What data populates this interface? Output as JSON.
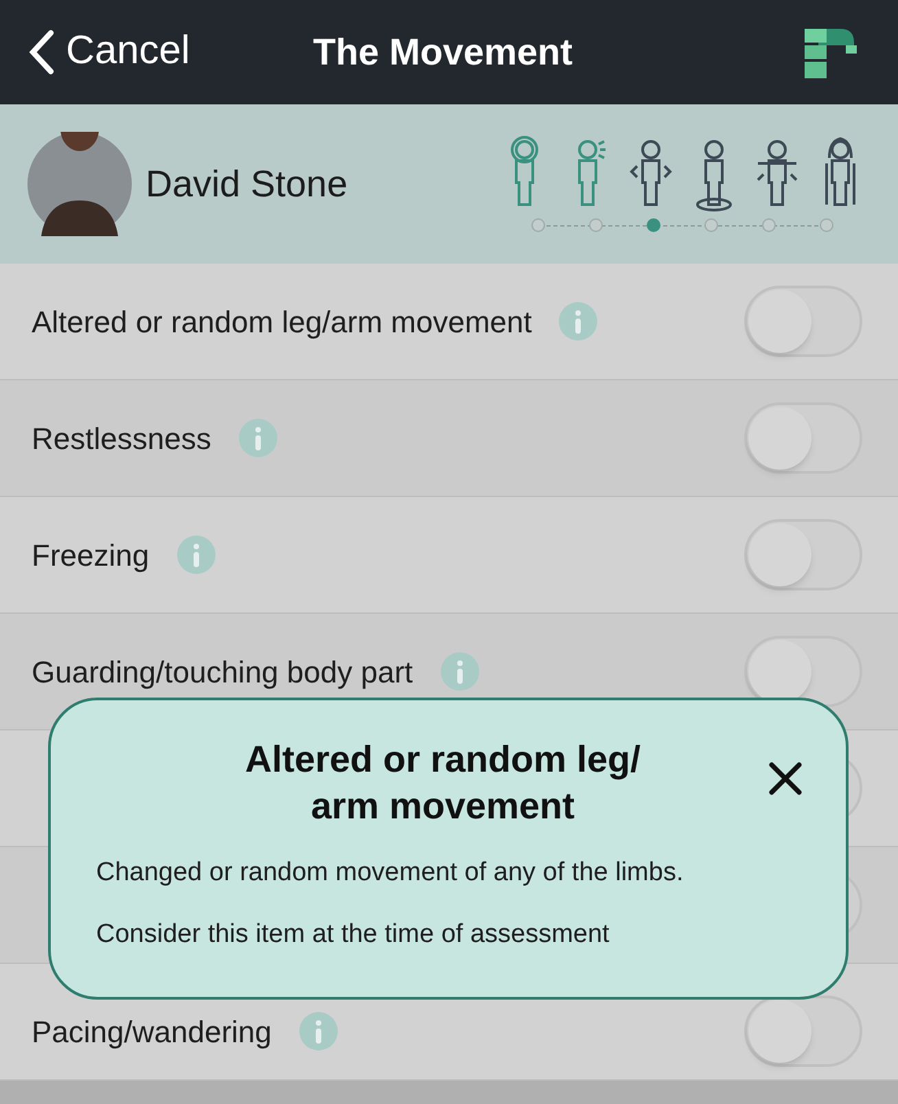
{
  "nav": {
    "back": "Cancel",
    "title": "The Movement"
  },
  "patient": {
    "name": "David Stone"
  },
  "stages": [
    {
      "done": true,
      "selected": false
    },
    {
      "done": true,
      "selected": false
    },
    {
      "done": false,
      "selected": true
    },
    {
      "done": false,
      "selected": false
    },
    {
      "done": false,
      "selected": false
    },
    {
      "done": false,
      "selected": false
    }
  ],
  "items": [
    {
      "label": "Altered or random leg/arm movement",
      "on": false
    },
    {
      "label": "Restlessness",
      "on": false
    },
    {
      "label": "Freezing",
      "on": false
    },
    {
      "label": "Guarding/touching body part",
      "on": false
    },
    {
      "on": false
    },
    {
      "on": false
    },
    {
      "label": "Pacing/wandering",
      "on": false
    }
  ],
  "popup": {
    "title": "Altered or random leg/ arm movement",
    "paragraphs": [
      "Changed or random movement of any of the limbs.",
      "Consider this item at the time of assessment"
    ]
  }
}
